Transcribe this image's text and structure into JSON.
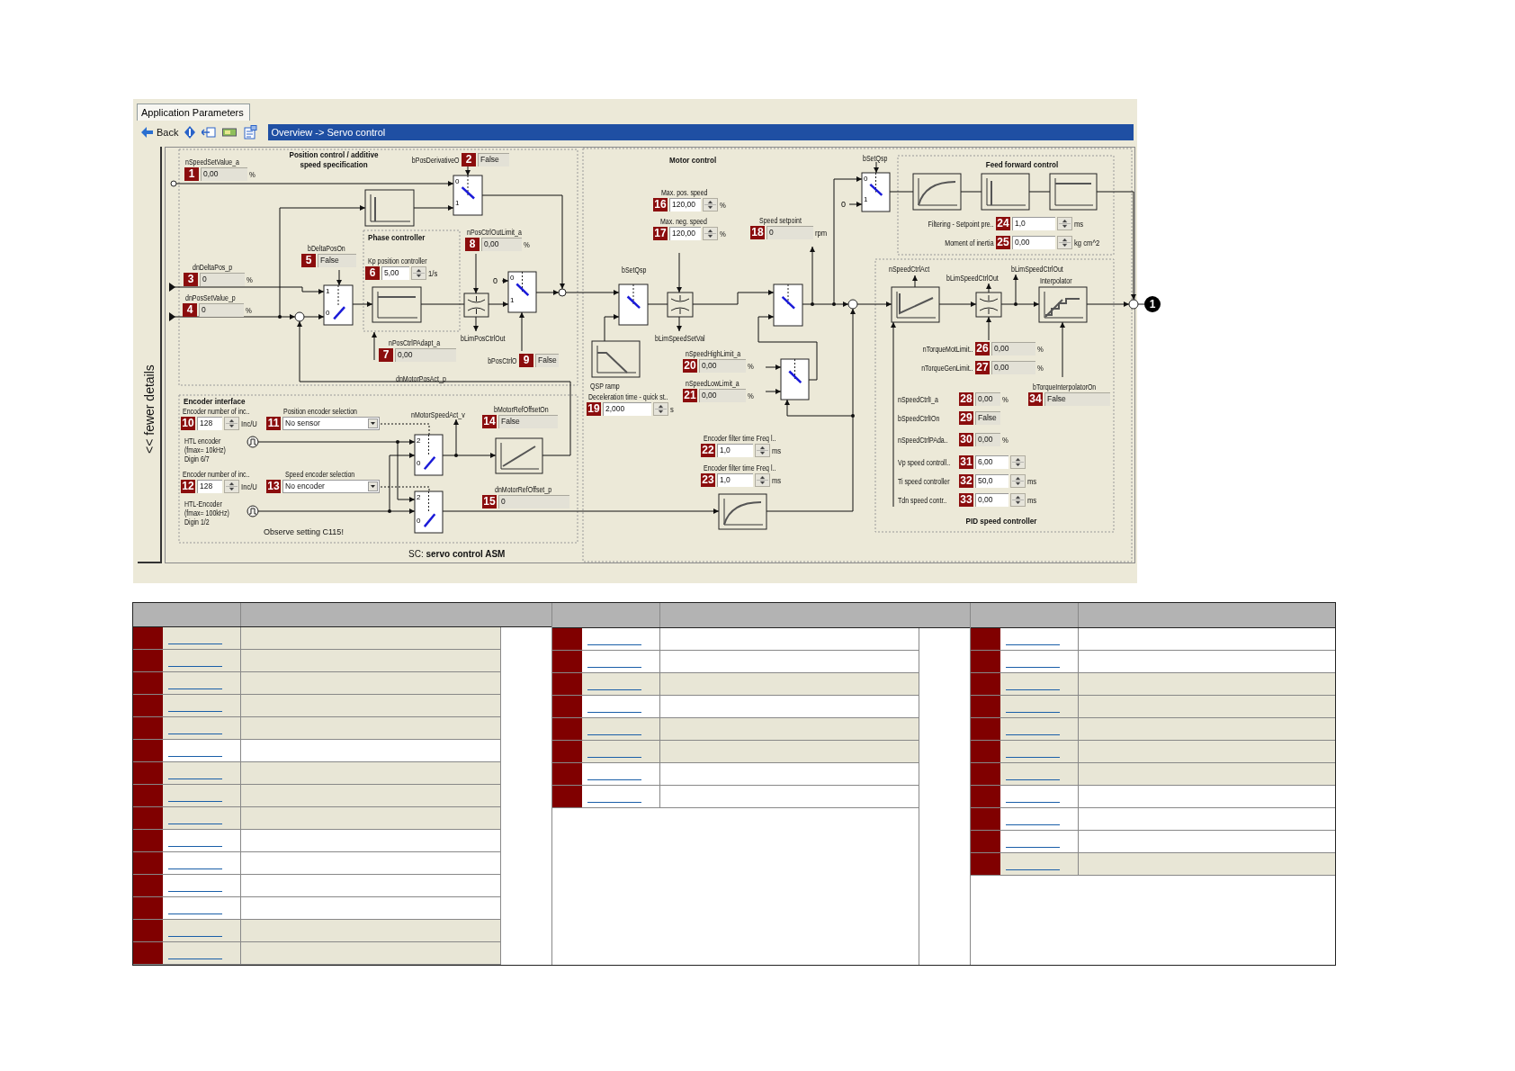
{
  "tab": {
    "label": "Application Parameters",
    "selected": true
  },
  "toolbar": {
    "back": "Back"
  },
  "breadcrumb": "Overview -> Servo control",
  "details_toggle": "<< fewer details",
  "diagram": {
    "sections": [
      {
        "title": "Position control / additive\nspeed specification"
      },
      {
        "title": "Phase controller"
      },
      {
        "title": "Encoder interface"
      },
      {
        "title": "Motor control"
      },
      {
        "title": "Feed forward control"
      },
      {
        "title": "PID speed controller"
      }
    ],
    "signals": [
      "dnMotorPosAct_p",
      "bLimPosCtrlOut",
      "nMotorSpeedAct_v",
      "bSetQsp",
      "bLimSpeedSetVal",
      "QSP ramp",
      "bSetQsp",
      "nSpeedCtrlAct",
      "bLimSpeedCtrlOut",
      "bLimSpeedCtrlOut",
      "Interpolator",
      "HTL encoder\n(fmax= 10kHz)\nDigin 6/7",
      "HTL-Encoder\n(fmax= 100kHz)\nDigin 1/2",
      "Observe setting C115!",
      "SC: **servo control ASM**"
    ],
    "switch_ports": [
      [
        "0",
        "1"
      ],
      [
        "1",
        "0"
      ],
      [
        "0",
        "1"
      ],
      [
        "2",
        "0"
      ],
      [
        "2",
        "0"
      ],
      [
        "0",
        "1"
      ]
    ],
    "constants": [
      "0",
      "0"
    ],
    "callout": "1",
    "params": [
      {
        "number": "1",
        "label": "nSpeedSetValue_a",
        "value": "0,00",
        "unit": "%",
        "kind": "display"
      },
      {
        "number": "2",
        "label": "bPosDerivativeO",
        "value": "False",
        "kind": "display"
      },
      {
        "number": "3",
        "label": "dnDeltaPos_p",
        "value": "0",
        "unit": "%",
        "kind": "display"
      },
      {
        "number": "4",
        "label": "dnPosSetValue_p",
        "value": "0",
        "unit": "%",
        "kind": "display"
      },
      {
        "number": "5",
        "label": "bDeltaPosOn",
        "value": "False",
        "kind": "display"
      },
      {
        "number": "6",
        "label": "Kp position controller",
        "value": "5,00",
        "unit": "1/s",
        "kind": "spin"
      },
      {
        "number": "7",
        "label": "nPosCtrlPAdapt_a",
        "value": "0,00",
        "kind": "display"
      },
      {
        "number": "8",
        "label": "nPosCtrlOutLimit_a",
        "value": "0,00",
        "unit": "%",
        "kind": "display"
      },
      {
        "number": "9",
        "label": "bPosCtrlO",
        "value": "False",
        "kind": "display"
      },
      {
        "number": "10",
        "label": "Encoder number of inc..",
        "value": "128",
        "unit": "Inc/U",
        "kind": "spin"
      },
      {
        "number": "11",
        "label": "Position encoder selection",
        "value": "No sensor",
        "kind": "dropdown"
      },
      {
        "number": "12",
        "label": "Encoder number of inc..",
        "value": "128",
        "unit": "Inc/U",
        "kind": "spin"
      },
      {
        "number": "13",
        "label": "Speed encoder selection",
        "value": "No encoder",
        "kind": "dropdown"
      },
      {
        "number": "14",
        "label": "bMotorRefOffsetOn",
        "value": "False",
        "kind": "display"
      },
      {
        "number": "15",
        "label": "dnMotorRefOffset_p",
        "value": "0",
        "kind": "display"
      },
      {
        "number": "16",
        "label": "Max. pos. speed",
        "value": "120,00",
        "unit": "%",
        "kind": "spin"
      },
      {
        "number": "17",
        "label": "Max. neg. speed",
        "value": "120,00",
        "unit": "%",
        "kind": "spin"
      },
      {
        "number": "18",
        "label": "Speed setpoint",
        "value": "0",
        "unit": "rpm",
        "kind": "display"
      },
      {
        "number": "19",
        "label": "Deceleration time - quick st..",
        "value": "2,000",
        "unit": "s",
        "kind": "spin"
      },
      {
        "number": "20",
        "label": "nSpeedHighLimit_a",
        "value": "0,00",
        "unit": "%",
        "kind": "display"
      },
      {
        "number": "21",
        "label": "nSpeedLowLimit_a",
        "value": "0,00",
        "unit": "%",
        "kind": "display"
      },
      {
        "number": "22",
        "label": "Encoder filter time Freq l..",
        "value": "1,0",
        "unit": "ms",
        "kind": "spin"
      },
      {
        "number": "23",
        "label": "Encoder filter time Freq l..",
        "value": "1,0",
        "unit": "ms",
        "kind": "spin"
      },
      {
        "number": "24",
        "label": "Filtering - Setpoint pre..",
        "value": "1,0",
        "unit": "ms",
        "kind": "spin"
      },
      {
        "number": "25",
        "label": "Moment of inertia",
        "value": "0,00",
        "unit": "kg cm^2",
        "kind": "spin"
      },
      {
        "number": "26",
        "label": "nTorqueMotLimit..",
        "value": "0,00",
        "unit": "%",
        "kind": "display"
      },
      {
        "number": "27",
        "label": "nTorqueGenLimit..",
        "value": "0,00",
        "unit": "%",
        "kind": "display"
      },
      {
        "number": "28",
        "label": "nSpeedCtrlI_a",
        "value": "0,00",
        "unit": "%",
        "kind": "display"
      },
      {
        "number": "29",
        "label": "bSpeedCtrlIOn",
        "value": "False",
        "kind": "display"
      },
      {
        "number": "30",
        "label": "nSpeedCtrlPAda..",
        "value": "0,00",
        "unit": "%",
        "kind": "display"
      },
      {
        "number": "31",
        "label": "Vp speed controll..",
        "value": "6,00",
        "kind": "spin"
      },
      {
        "number": "32",
        "label": "Ti speed controller",
        "value": "50,0",
        "unit": "ms",
        "kind": "spin"
      },
      {
        "number": "33",
        "label": "Tdn speed contr..",
        "value": "0,00",
        "unit": "ms",
        "kind": "spin"
      },
      {
        "number": "34",
        "label": "bTorqueInterpolatorOn",
        "value": "False",
        "kind": "display"
      }
    ]
  },
  "table": {
    "groups": [
      {
        "rows": [
          {
            "shaded": true
          },
          {
            "shaded": true
          },
          {
            "shaded": true
          },
          {
            "shaded": true
          },
          {
            "shaded": true
          },
          {
            "shaded": false
          },
          {
            "shaded": true
          },
          {
            "shaded": true
          },
          {
            "shaded": true
          },
          {
            "shaded": false
          },
          {
            "shaded": false
          },
          {
            "shaded": false
          },
          {
            "shaded": false
          },
          {
            "shaded": true
          },
          {
            "shaded": true
          }
        ]
      },
      {
        "rows": [
          {
            "shaded": false
          },
          {
            "shaded": false
          },
          {
            "shaded": true
          },
          {
            "shaded": false
          },
          {
            "shaded": true
          },
          {
            "shaded": true
          },
          {
            "shaded": false
          },
          {
            "shaded": false
          }
        ]
      },
      {
        "rows": [
          {
            "shaded": false
          },
          {
            "shaded": false
          },
          {
            "shaded": true
          },
          {
            "shaded": true
          },
          {
            "shaded": true
          },
          {
            "shaded": true
          },
          {
            "shaded": true
          },
          {
            "shaded": false
          },
          {
            "shaded": false
          },
          {
            "shaded": false
          },
          {
            "shaded": true
          }
        ]
      }
    ]
  }
}
